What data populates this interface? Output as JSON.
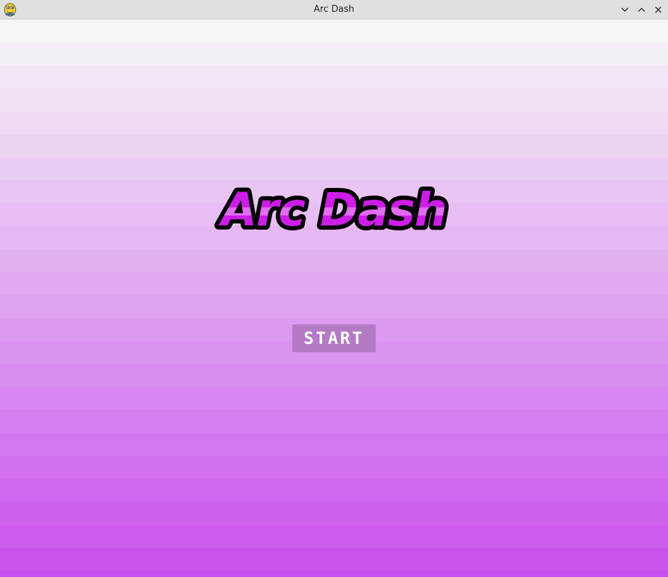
{
  "window": {
    "title": "Arc Dash",
    "icon": "pygame-snake-icon",
    "controls": [
      "minimize-icon",
      "maximize-icon",
      "close-icon"
    ]
  },
  "game": {
    "logo_text": "Arc Dash",
    "start_label": "START"
  },
  "colors": {
    "titlebar": "#dee0e2",
    "background_top": "#f6f6f6",
    "background_bottom": "#c84ded",
    "logo_fill": "#cc1ee6",
    "logo_fill_light": "#e26cf3",
    "logo_outline": "#000000",
    "start_button": "#b57ac6"
  }
}
